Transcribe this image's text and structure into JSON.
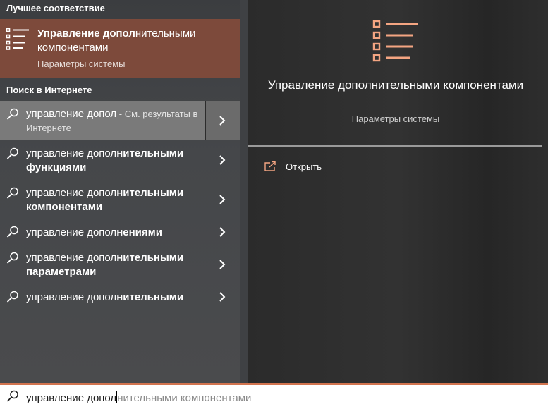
{
  "best_match": {
    "header": "Лучшее соответствие",
    "title_bold": "Управление допол",
    "title_rest": "нительными компонентами",
    "subtitle": "Параметры системы"
  },
  "web": {
    "header": "Поиск в Интернете",
    "rows": [
      {
        "typed": "управление допол",
        "completion": "",
        "suffix": " - См. результаты в Интернете"
      },
      {
        "typed": "управление допол",
        "completion": "нительными функциями",
        "suffix": ""
      },
      {
        "typed": "управление допол",
        "completion": "нительными компонентами",
        "suffix": ""
      },
      {
        "typed": "управление допол",
        "completion": "нениями",
        "suffix": ""
      },
      {
        "typed": "управление допол",
        "completion": "нительными параметрами",
        "suffix": ""
      },
      {
        "typed": "управление допол",
        "completion": "нительными",
        "suffix": ""
      }
    ]
  },
  "detail": {
    "title": "Управление дополнительными компонентами",
    "subtitle": "Параметры системы",
    "open_label": "Открыть"
  },
  "search": {
    "typed": "управление допол",
    "suggestion": "нительными компонентами"
  },
  "icons": {
    "best_match": "list-settings-icon",
    "search": "search-icon",
    "chevron": "chevron-right-icon",
    "open": "open-icon"
  },
  "colors": {
    "accent": "#d2744f",
    "selected_item": "#7d4a3b",
    "icon_accent": "#f4a582"
  }
}
